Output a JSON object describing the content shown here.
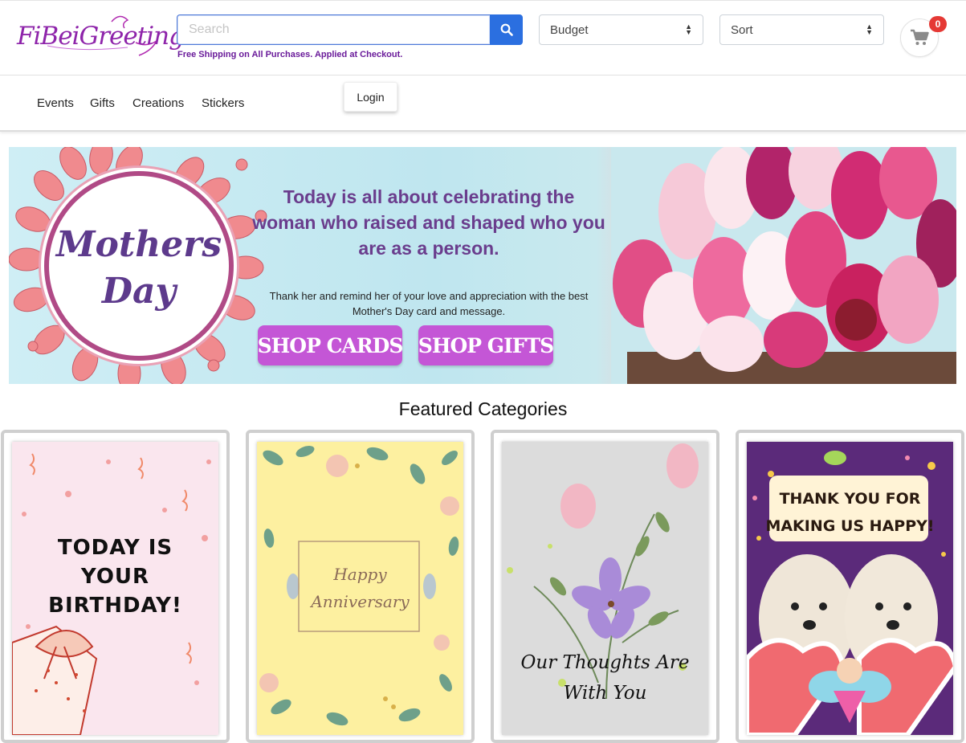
{
  "header": {
    "logo_text": "FiBeiGreetings",
    "search": {
      "placeholder": "Search",
      "value": ""
    },
    "shipping_note": "Free Shipping on All Purchases. Applied at Checkout.",
    "budget_select": {
      "selected": "Budget"
    },
    "sort_select": {
      "selected": "Sort"
    },
    "cart": {
      "count": "0",
      "icon": "cart-icon"
    }
  },
  "nav": {
    "items": [
      {
        "label": "Events"
      },
      {
        "label": "Gifts"
      },
      {
        "label": "Creations"
      },
      {
        "label": "Stickers"
      }
    ],
    "login_label": "Login"
  },
  "banner": {
    "seal_line1": "Mothers",
    "seal_line2": "Day",
    "headline": "Today is all about celebrating the woman who raised and shaped who you are as a person.",
    "subtext": "Thank her and remind her of your love and appreciation with the best Mother's Day card and message.",
    "shop_cards_label": "SHOP CARDS",
    "shop_gifts_label": "SHOP GIFTS"
  },
  "featured": {
    "title": "Featured Categories",
    "cards": [
      {
        "text_lines": [
          "TODAY IS",
          "YOUR",
          "BIRTHDAY!"
        ]
      },
      {
        "text_lines": [
          "Happy",
          "Anniversary"
        ]
      },
      {
        "text_lines": [
          "Our Thoughts Are",
          "With You"
        ]
      },
      {
        "text_lines": [
          "THANK YOU FOR",
          "MAKING US HAPPY!"
        ]
      }
    ]
  },
  "colors": {
    "brand_purple": "#8e24aa",
    "search_blue": "#2b6fe0",
    "badge_red": "#e53935",
    "banner_button": "#c456d6"
  }
}
